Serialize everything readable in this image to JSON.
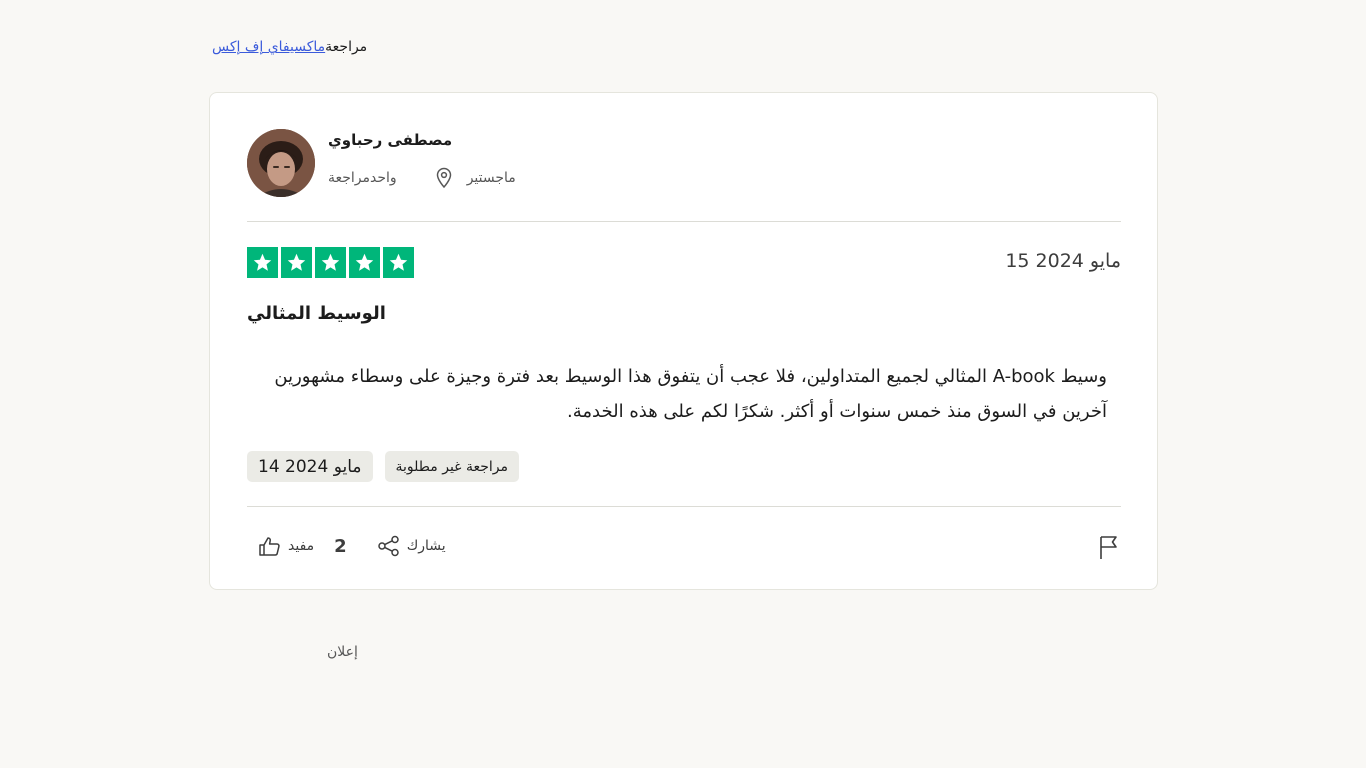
{
  "breadcrumb": {
    "link": "ماكسيفاي إف إكس",
    "current": "مراجعة"
  },
  "review": {
    "user": {
      "name": "مصطفى رحباوي",
      "location": "ماجستير",
      "review_count": "واحدمراجعة"
    },
    "rating": 5,
    "date": "15 مايو 2024",
    "title": "الوسيط المثالي",
    "body": "وسيط A-book المثالي لجميع المتداولين، فلا عجب أن يتفوق هذا الوسيط بعد فترة وجيزة على وسطاء مشهورين آخرين في السوق منذ خمس سنوات أو أكثر. شكرًا لكم على هذه الخدمة.",
    "tags": {
      "experience_date": "14 مايو 2024",
      "unprompted": "مراجعة غير مطلوبة"
    },
    "actions": {
      "useful_label": "مفيد",
      "useful_count": "2",
      "share_label": "يشارك"
    }
  },
  "ad_label": "إعلان",
  "colors": {
    "star_green": "#00b67a",
    "link_blue": "#3b5bdb",
    "background": "#f9f8f5"
  },
  "icons": [
    "location-pin-icon",
    "star-icon",
    "thumbs-up-icon",
    "share-icon",
    "flag-icon"
  ]
}
